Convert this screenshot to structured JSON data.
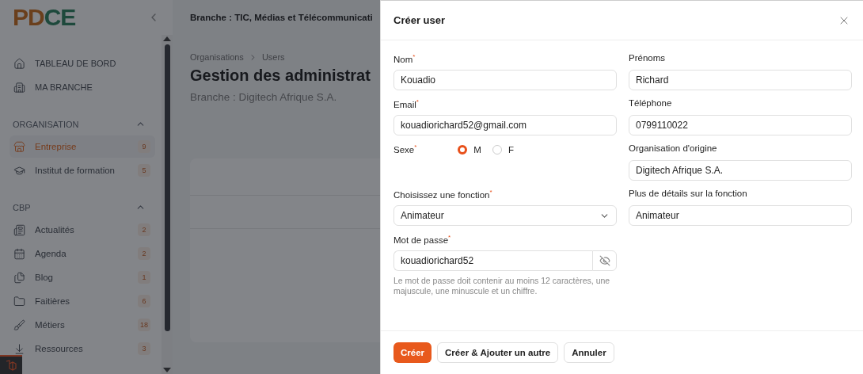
{
  "logo": "PDCE",
  "header": {
    "title": "Branche : TIC, Médias et Télécommunicati"
  },
  "sidebar": {
    "top_items": [
      {
        "label": "TABLEAU DE BORD",
        "selected": false
      },
      {
        "label": "MA BRANCHE",
        "selected": false
      }
    ],
    "sections": [
      {
        "title": "ORGANISATION",
        "expanded": true,
        "items": [
          {
            "label": "Entreprise",
            "count": "9",
            "selected": true
          },
          {
            "label": "Institut de formation",
            "count": "5",
            "selected": false
          }
        ]
      },
      {
        "title": "CBP",
        "expanded": true,
        "items": [
          {
            "label": "Actualités",
            "count": "2",
            "selected": false
          },
          {
            "label": "Agenda",
            "count": "2",
            "selected": false
          },
          {
            "label": "Blog",
            "count": "1",
            "selected": false
          },
          {
            "label": "Faitières",
            "count": "6",
            "selected": false
          },
          {
            "label": "Métiers",
            "count": "18",
            "selected": false
          },
          {
            "label": "Ressources",
            "count": "3",
            "selected": false
          }
        ]
      }
    ]
  },
  "breadcrumb": [
    "Organisations",
    "Users"
  ],
  "page": {
    "title": "Gestion des administrat",
    "subtitle": "Branche : Digitech Afrique S.A."
  },
  "modal": {
    "title": "Créer user",
    "rows": [
      [
        {
          "kind": "text",
          "label": "Nom$^{*}$",
          "value": "Kouadio"
        },
        {
          "kind": "text",
          "label": "Prénoms",
          "value": "Richard"
        }
      ],
      [
        {
          "kind": "text",
          "label": "Email$^{*}$",
          "value": "kouadiorichard52@gmail.com"
        },
        {
          "kind": "text",
          "label": "Téléphone",
          "value": "0799110022"
        }
      ],
      [
        {
          "kind": "radio",
          "label": "Sexe$^{*}$",
          "options": [
            {
              "label": "M",
              "selected": true
            },
            {
              "label": "F",
              "selected": false
            }
          ]
        },
        {
          "kind": "text",
          "label": "Organisation d'origine",
          "value": "Digitech Afrique S.A."
        }
      ],
      [
        {
          "kind": "select",
          "label": "Choisissez une fonction$^{*}$",
          "value": "Animateur"
        },
        {
          "kind": "text",
          "label": "Plus de détails sur la fonction",
          "value": "Animateur"
        }
      ],
      [
        {
          "kind": "password",
          "label": "Mot de passe$^{*}$",
          "value": "kouadiorichard52",
          "help": "Le mot de passe doit contenir au moins 12 caractères, une majuscule, une minuscule et un chiffre."
        }
      ]
    ],
    "buttons": [
      {
        "label": "Créer",
        "kind": "primary"
      },
      {
        "label": "Créer & Ajouter un autre",
        "kind": "secondary"
      },
      {
        "label": "Annuler",
        "kind": "secondary"
      }
    ]
  }
}
